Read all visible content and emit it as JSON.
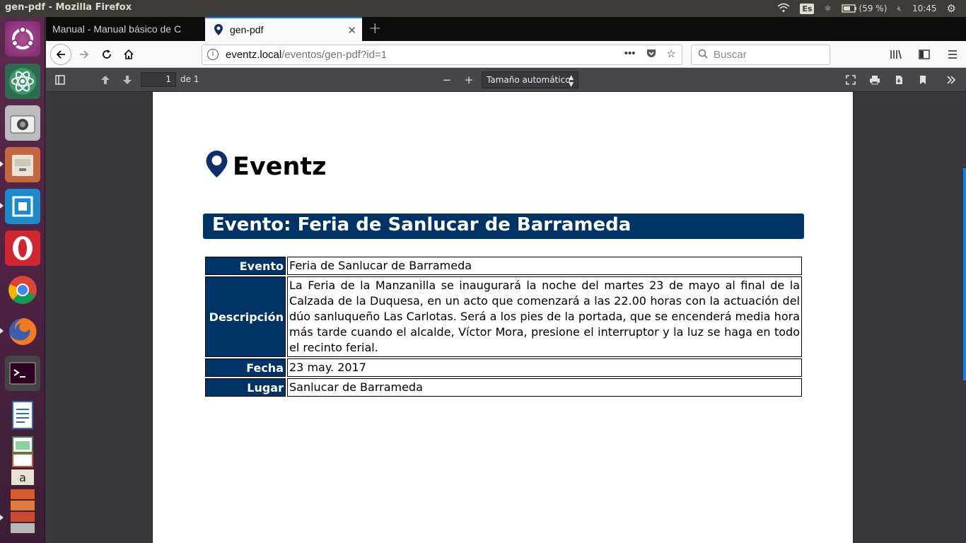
{
  "window": {
    "title": "gen-pdf - Mozilla Firefox"
  },
  "tray": {
    "lang": "Es",
    "battery": "(59 %)",
    "time": "10:45"
  },
  "launcher": [
    "ubuntu-dash",
    "atom",
    "camera",
    "files",
    "vmware",
    "opera",
    "chrome",
    "firefox",
    "terminal",
    "writer",
    "calc",
    "impress",
    "amazon",
    "stack"
  ],
  "tabs": [
    {
      "label": "Manual - Manual básico de C",
      "active": false
    },
    {
      "label": "gen-pdf",
      "active": true
    }
  ],
  "navbar": {
    "url_domain": "eventz.local",
    "url_path": "/eventos/gen-pdf?id=1",
    "more": "•••",
    "search_placeholder": "Buscar"
  },
  "pdf_toolbar": {
    "page_value": "1",
    "page_count": "de 1",
    "zoom_label": "Tamaño automático"
  },
  "document": {
    "brand": "Eventz",
    "heading": "Evento: Feria de Sanlucar de Barrameda",
    "rows": [
      {
        "label": "Evento",
        "value": "Feria de Sanlucar de Barrameda"
      },
      {
        "label": "Descripción",
        "value": "La Feria de la Manzanilla se inaugurará la noche del martes 23 de mayo al final de la Calzada de la Duquesa, en un acto que comenzará a las 22.00 horas con la actuación del dúo sanluqueño Las Carlotas. Será a los pies de la portada, que se encenderá media hora más tarde cuando el alcalde, Víctor Mora, presione el interruptor y la luz se haga en todo el recinto ferial."
      },
      {
        "label": "Fecha",
        "value": "23 may. 2017"
      },
      {
        "label": "Lugar",
        "value": "Sanlucar de Barrameda"
      }
    ]
  },
  "colors": {
    "accent": "#003366",
    "tab_highlight": "#0a84ff"
  }
}
